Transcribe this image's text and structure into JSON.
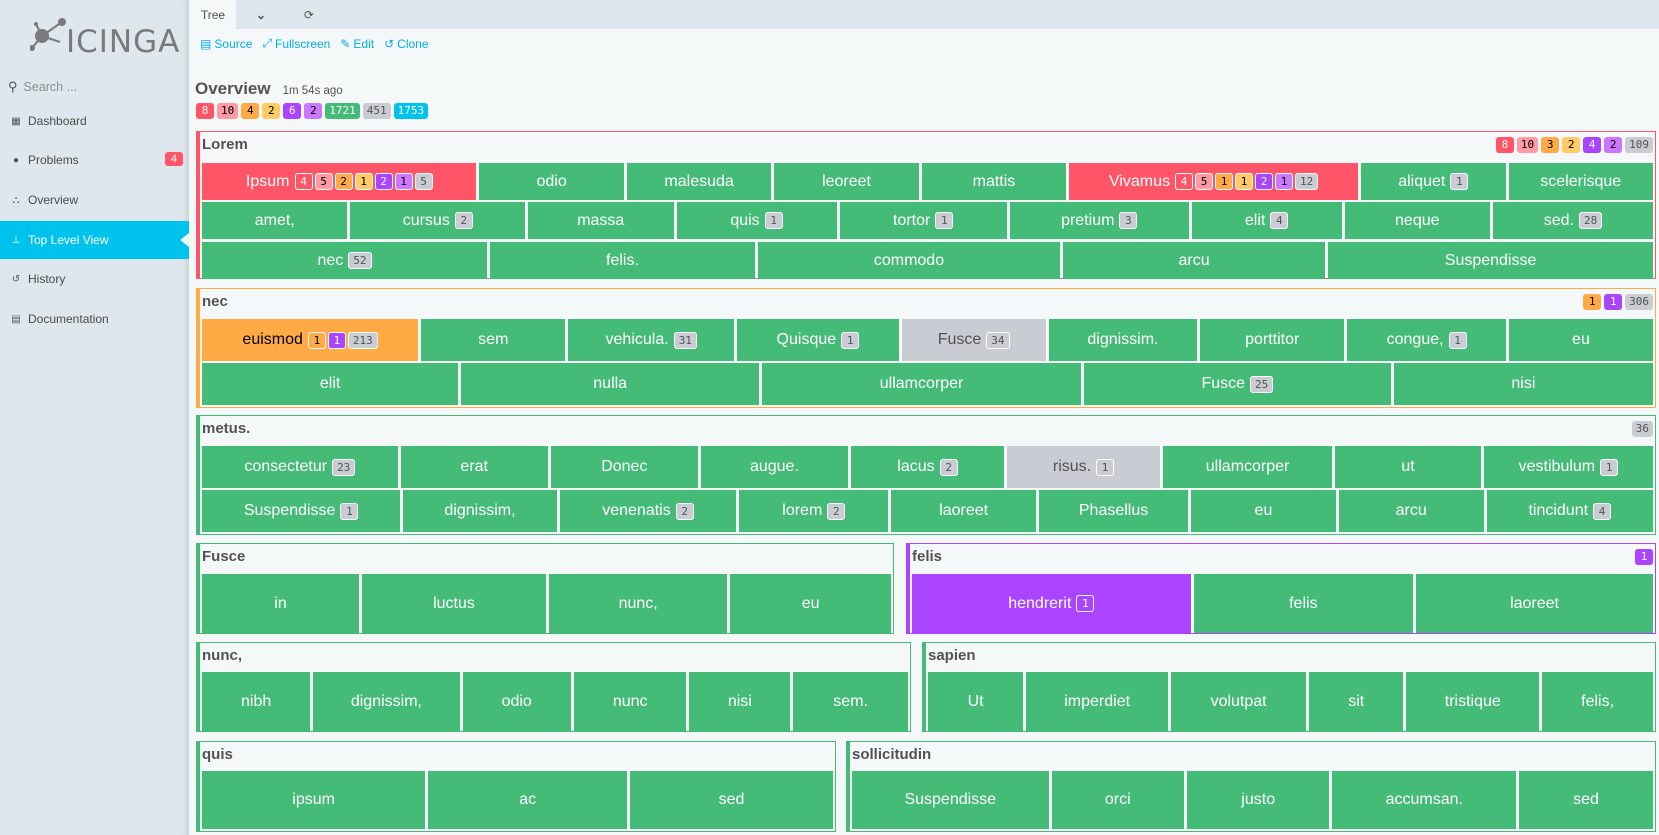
{
  "app": {
    "logo_text": "icinga"
  },
  "sidebar": {
    "search_placeholder": "Search ...",
    "items": [
      {
        "label": "Dashboard",
        "icon": "grid-icon",
        "glyph": "▦"
      },
      {
        "label": "Problems",
        "icon": "alert-circle-icon",
        "glyph": "●",
        "badge": "4"
      },
      {
        "label": "Overview",
        "icon": "binoculars-icon",
        "glyph": "⛬"
      },
      {
        "label": "Top Level View",
        "icon": "sitemap-icon",
        "glyph": "⊥",
        "active": true
      },
      {
        "label": "History",
        "icon": "history-icon",
        "glyph": "↺"
      },
      {
        "label": "Documentation",
        "icon": "book-icon",
        "glyph": "▤"
      }
    ]
  },
  "tabs": {
    "active": "Tree",
    "dropdown_glyph": "⌄",
    "refresh_glyph": "⟳"
  },
  "actions": [
    {
      "label": "Source",
      "icon": "file-icon",
      "glyph": "▤"
    },
    {
      "label": "Fullscreen",
      "icon": "expand-icon",
      "glyph": "⤢"
    },
    {
      "label": "Edit",
      "icon": "edit-icon",
      "glyph": "✎"
    },
    {
      "label": "Clone",
      "icon": "clone-icon",
      "glyph": "↺"
    }
  ],
  "overview": {
    "title": "Overview",
    "ago": "1m 54s ago",
    "badges": [
      {
        "v": "8",
        "s": "crit"
      },
      {
        "v": "10",
        "s": "crith"
      },
      {
        "v": "4",
        "s": "warn"
      },
      {
        "v": "2",
        "s": "warnh"
      },
      {
        "v": "6",
        "s": "unk"
      },
      {
        "v": "2",
        "s": "unkh"
      },
      {
        "v": "1721",
        "s": "ok"
      },
      {
        "v": "451",
        "s": "pend"
      },
      {
        "v": "1753",
        "s": "info"
      }
    ]
  },
  "groups": [
    {
      "title": "Lorem",
      "state": "crit",
      "badges": [
        {
          "v": "8",
          "s": "crit"
        },
        {
          "v": "10",
          "s": "crith"
        },
        {
          "v": "3",
          "s": "warn"
        },
        {
          "v": "2",
          "s": "warnh"
        },
        {
          "v": "4",
          "s": "unk"
        },
        {
          "v": "2",
          "s": "unkh"
        },
        {
          "v": "109",
          "s": "pend"
        }
      ],
      "rows": [
        [
          {
            "n": "Ipsum",
            "s": "crit",
            "w": 1.9,
            "b": [
              {
                "v": "4",
                "s": "crit"
              },
              {
                "v": "5",
                "s": "crith"
              },
              {
                "v": "2",
                "s": "warn"
              },
              {
                "v": "1",
                "s": "warnh"
              },
              {
                "v": "2",
                "s": "unk"
              },
              {
                "v": "1",
                "s": "unkh"
              },
              {
                "v": "5",
                "s": "pend"
              }
            ]
          },
          {
            "n": "odio",
            "w": 1
          },
          {
            "n": "malesuda",
            "w": 1
          },
          {
            "n": "leoreet",
            "w": 1
          },
          {
            "n": "mattis",
            "w": 1
          },
          {
            "n": "Vivamus",
            "s": "crit",
            "w": 2.0,
            "b": [
              {
                "v": "4",
                "s": "crit"
              },
              {
                "v": "5",
                "s": "crith"
              },
              {
                "v": "1",
                "s": "warn"
              },
              {
                "v": "1",
                "s": "warnh"
              },
              {
                "v": "2",
                "s": "unk"
              },
              {
                "v": "1",
                "s": "unkh"
              },
              {
                "v": "12",
                "s": "pend"
              }
            ]
          },
          {
            "n": "aliquet",
            "w": 1,
            "b": [
              {
                "v": "1",
                "s": "pend"
              }
            ]
          },
          {
            "n": "scelerisque",
            "w": 1
          }
        ],
        [
          {
            "n": "amet,",
            "w": 1
          },
          {
            "n": "cursus",
            "w": 1.2,
            "b": [
              {
                "v": "2",
                "s": "pend"
              }
            ]
          },
          {
            "n": "massa",
            "w": 1
          },
          {
            "n": "quis",
            "w": 1.1,
            "b": [
              {
                "v": "1",
                "s": "pend"
              }
            ]
          },
          {
            "n": "tortor",
            "w": 1.15,
            "b": [
              {
                "v": "1",
                "s": "pend"
              }
            ]
          },
          {
            "n": "pretium",
            "w": 1.23,
            "b": [
              {
                "v": "3",
                "s": "pend"
              }
            ]
          },
          {
            "n": "elit",
            "w": 1.03,
            "b": [
              {
                "v": "4",
                "s": "pend"
              }
            ]
          },
          {
            "n": "neque",
            "w": 1
          },
          {
            "n": "sed.",
            "w": 1.1,
            "b": [
              {
                "v": "28",
                "s": "pend"
              }
            ]
          }
        ],
        [
          {
            "n": "nec",
            "w": 1,
            "b": [
              {
                "v": "52",
                "s": "pend"
              }
            ]
          },
          {
            "n": "felis.",
            "w": 0.93
          },
          {
            "n": "commodo",
            "w": 1.06
          },
          {
            "n": "arcu",
            "w": 0.92
          },
          {
            "n": "Suspendisse",
            "w": 1.14
          }
        ]
      ]
    },
    {
      "title": "nec",
      "state": "warn",
      "badges": [
        {
          "v": "1",
          "s": "warn"
        },
        {
          "v": "1",
          "s": "unk"
        },
        {
          "v": "306",
          "s": "pend"
        }
      ],
      "rows": [
        [
          {
            "n": "euismod",
            "s": "warn",
            "w": 1.5,
            "b": [
              {
                "v": "1",
                "s": "warn"
              },
              {
                "v": "1",
                "s": "unk"
              },
              {
                "v": "213",
                "s": "pend"
              }
            ]
          },
          {
            "n": "sem",
            "w": 1
          },
          {
            "n": "vehicula.",
            "w": 1.15,
            "b": [
              {
                "v": "31",
                "s": "pend"
              }
            ]
          },
          {
            "n": "Quisque",
            "w": 1.12,
            "b": [
              {
                "v": "1",
                "s": "pend"
              }
            ]
          },
          {
            "n": "Fusce",
            "s": "pend",
            "w": 1,
            "b": [
              {
                "v": "34",
                "s": "pend"
              }
            ]
          },
          {
            "n": "dignissim.",
            "w": 1.03
          },
          {
            "n": "porttitor",
            "w": 1
          },
          {
            "n": "congue,",
            "w": 1.1,
            "b": [
              {
                "v": "1",
                "s": "pend"
              }
            ]
          },
          {
            "n": "eu",
            "w": 1
          }
        ],
        [
          {
            "n": "elit",
            "w": 0.86
          },
          {
            "n": "nulla",
            "w": 1
          },
          {
            "n": "ullamcorper",
            "w": 1.07
          },
          {
            "n": "Fusce",
            "w": 1.03,
            "b": [
              {
                "v": "25",
                "s": "pend"
              }
            ]
          },
          {
            "n": "nisi",
            "w": 0.87
          }
        ]
      ]
    },
    {
      "title": "metus.",
      "state": "ok",
      "badges": [
        {
          "v": "36",
          "s": "pend"
        }
      ],
      "rows": [
        [
          {
            "n": "consectetur",
            "w": 1.33,
            "b": [
              {
                "v": "23",
                "s": "pend"
              }
            ]
          },
          {
            "n": "erat",
            "w": 1
          },
          {
            "n": "Donec",
            "w": 1
          },
          {
            "n": "augue.",
            "w": 1
          },
          {
            "n": "lacus",
            "w": 1.04,
            "b": [
              {
                "v": "2",
                "s": "pend"
              }
            ]
          },
          {
            "n": "risus.",
            "s": "pend",
            "w": 1.04,
            "b": [
              {
                "v": "1",
                "s": "pend"
              }
            ]
          },
          {
            "n": "ullamcorper",
            "w": 1.15
          },
          {
            "n": "ut",
            "w": 0.99
          },
          {
            "n": "vestibulum",
            "w": 1.15,
            "b": [
              {
                "v": "1",
                "s": "pend"
              }
            ]
          }
        ],
        [
          {
            "n": "Suspendisse",
            "w": 1.37,
            "b": [
              {
                "v": "1",
                "s": "pend"
              }
            ]
          },
          {
            "n": "dignissim,",
            "w": 1.06
          },
          {
            "n": "venenatis",
            "w": 1.22,
            "b": [
              {
                "v": "2",
                "s": "pend"
              }
            ]
          },
          {
            "n": "lorem",
            "w": 1.03,
            "b": [
              {
                "v": "2",
                "s": "pend"
              }
            ]
          },
          {
            "n": "laoreet",
            "w": 1
          },
          {
            "n": "Phasellus",
            "w": 1.03
          },
          {
            "n": "eu",
            "w": 1
          },
          {
            "n": "arcu",
            "w": 1
          },
          {
            "n": "tincidunt",
            "w": 1.15,
            "b": [
              {
                "v": "4",
                "s": "pend"
              }
            ]
          }
        ]
      ]
    },
    {
      "title": "Fusce",
      "state": "ok",
      "badges": [],
      "rows": [
        [
          {
            "n": "in",
            "w": 0.88
          },
          {
            "n": "luctus",
            "w": 1.03
          },
          {
            "n": "nunc,",
            "w": 1
          },
          {
            "n": "eu",
            "w": 0.9
          }
        ]
      ]
    },
    {
      "title": "felis",
      "state": "unk",
      "badges": [
        {
          "v": "1",
          "s": "unk"
        }
      ],
      "rows": [
        [
          {
            "n": "hendrerit",
            "s": "unk",
            "w": 1.27,
            "b": [
              {
                "v": "1",
                "s": "unk"
              }
            ]
          },
          {
            "n": "felis",
            "w": 1
          },
          {
            "n": "laoreet",
            "w": 1.08
          }
        ]
      ]
    },
    {
      "title": "nunc,",
      "state": "ok",
      "badges": [],
      "rows": [
        [
          {
            "n": "nibh",
            "w": 1
          },
          {
            "n": "dignissim,",
            "w": 1.35
          },
          {
            "n": "odio",
            "w": 1
          },
          {
            "n": "nunc",
            "w": 1.04
          },
          {
            "n": "nisi",
            "w": 0.93
          },
          {
            "n": "sem.",
            "w": 1.06
          }
        ]
      ]
    },
    {
      "title": "sapien",
      "state": "ok",
      "badges": [],
      "rows": [
        [
          {
            "n": "Ut",
            "w": 0.86
          },
          {
            "n": "imperdiet",
            "w": 1.28
          },
          {
            "n": "volutpat",
            "w": 1.22
          },
          {
            "n": "sit",
            "w": 0.85
          },
          {
            "n": "tristique",
            "w": 1.2
          },
          {
            "n": "felis,",
            "w": 1
          }
        ]
      ]
    },
    {
      "title": "quis",
      "state": "ok",
      "badges": [],
      "rows": [
        [
          {
            "n": "ipsum",
            "w": 1.1
          },
          {
            "n": "ac",
            "w": 0.98
          },
          {
            "n": "sed",
            "w": 1
          }
        ]
      ]
    },
    {
      "title": "sollicitudin",
      "state": "ok",
      "badges": [],
      "rows": [
        [
          {
            "n": "Suspendisse",
            "w": 1.38
          },
          {
            "n": "orci",
            "w": 0.93
          },
          {
            "n": "justo",
            "w": 1
          },
          {
            "n": "accumsan.",
            "w": 1.29
          },
          {
            "n": "sed",
            "w": 0.94
          }
        ]
      ]
    }
  ]
}
